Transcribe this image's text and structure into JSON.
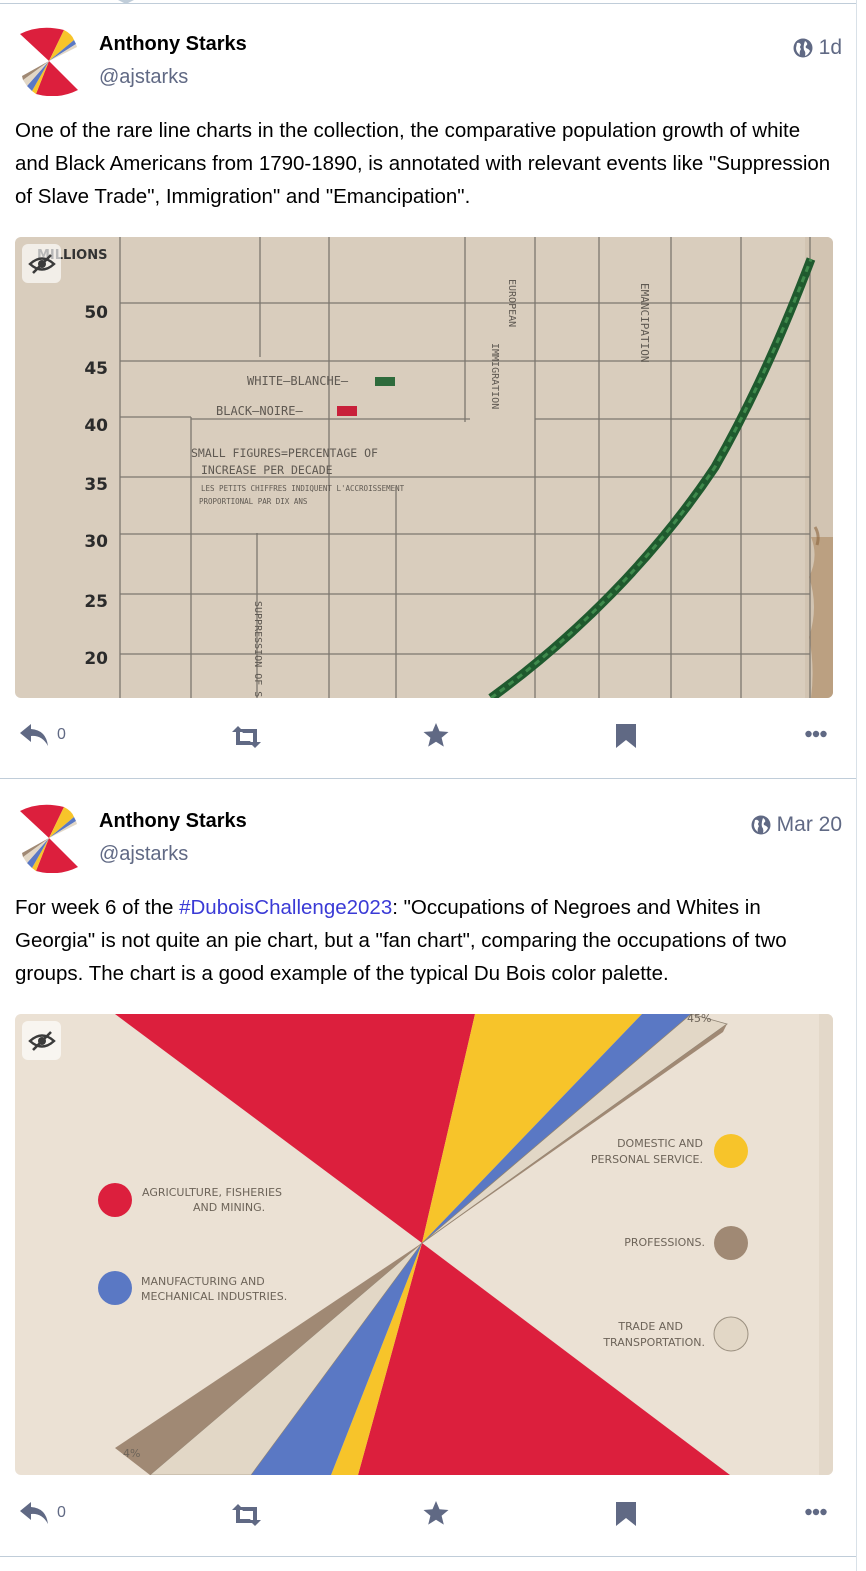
{
  "posts": [
    {
      "author_name": "Anthony Starks",
      "author_handle": "@ajstarks",
      "timestamp": "1d",
      "visibility_icon": "globe-icon",
      "text": "One of the rare line charts in the collection, the comparative population growth of white and Black Americans from 1790-1890, is annotated with relevant events like \"Suppression of Slave Trade\", Immigration\" and  \"Emancipation\".",
      "media": {
        "y_axis_title": "MILLIONS",
        "y_ticks": [
          "50",
          "45",
          "40",
          "35",
          "30",
          "25",
          "20"
        ],
        "legend_white": "WHITE—BLANCHE—",
        "legend_black": "BLACK—NOIRE—",
        "note_line1": "SMALL FIGURES=PERCENTAGE OF",
        "note_line2": "INCREASE PER DECADE",
        "note_line3": "LES PETITS CHIFFRES INDIQUENT L'ACCROISSEMENT",
        "note_line4": "PROPORTIONAL PAR DIX ANS",
        "annotation_european": "EUROPEAN",
        "annotation_immigration": "IMMIGRATION",
        "annotation_emancipation": "EMANCIPATION",
        "annotation_suppression": "SUPPRESSION OF S",
        "colors": {
          "white_line": "#2e6b3c",
          "black_swatch": "#c8203a",
          "paper": "#d9cdbd"
        }
      },
      "reply_count": "0"
    },
    {
      "author_name": "Anthony Starks",
      "author_handle": "@ajstarks",
      "timestamp": "Mar 20",
      "visibility_icon": "globe-icon",
      "text_before": "For week 6 of the ",
      "hashtag": "#DuboisChallenge2023",
      "text_after": ": \"Occupations of Negroes and Whites in Georgia\" is not quite an pie chart, but a \"fan chart\", comparing the occupations of two groups. The chart is a good example of the typical Du Bois color palette.",
      "media": {
        "legend_agriculture_1": "AGRICULTURE, FISHERIES",
        "legend_agriculture_2": "AND MINING.",
        "legend_manufacturing_1": "MANUFACTURING AND",
        "legend_manufacturing_2": "MECHANICAL INDUSTRIES.",
        "legend_domestic_1": "DOMESTIC AND",
        "legend_domestic_2": "PERSONAL SERVICE.",
        "legend_professions": "PROFESSIONS.",
        "legend_trade_1": "TRADE AND",
        "legend_trade_2": "TRANSPORTATION.",
        "pct_top": "45%",
        "pct_bottom": "4%",
        "colors": {
          "red": "#dc1f3d",
          "yellow": "#f7c42a",
          "blue": "#5a78c4",
          "brown": "#a08974",
          "tan": "#e2d7c6",
          "paper": "#ebe1d4"
        }
      },
      "reply_count": "0"
    }
  ]
}
